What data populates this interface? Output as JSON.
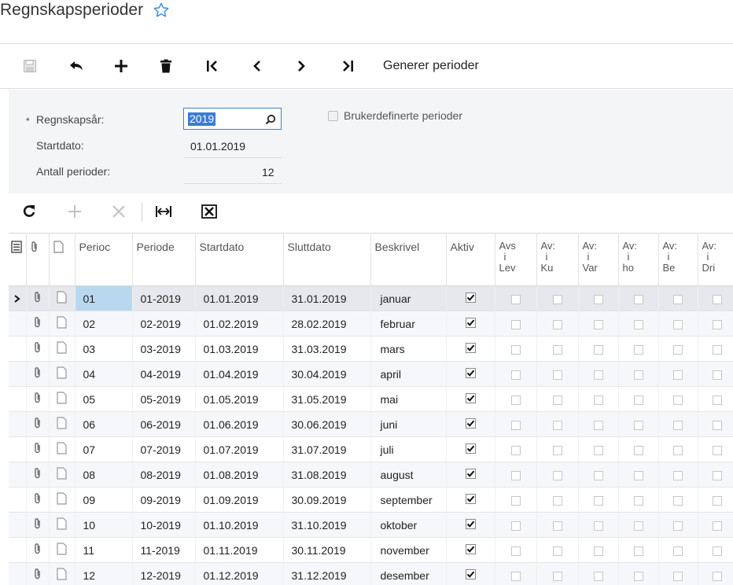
{
  "page": {
    "title": "Regnskapsperioder"
  },
  "toolbar": {
    "generate_label": "Generer perioder"
  },
  "form": {
    "year_label": "Regnskapsår:",
    "required_mark": "*",
    "year_value": "2019",
    "start_label": "Startdato:",
    "start_value": "01.01.2019",
    "count_label": "Antall perioder:",
    "count_value": "12",
    "custom_periods_label": "Brukerdefinerte perioder",
    "custom_periods_checked": false
  },
  "grid": {
    "columns": [
      "Perioc",
      "Periode",
      "Startdato",
      "Sluttdato",
      "Beskrivel",
      "Aktiv",
      "Avs i Lev",
      "Avs i Ku",
      "Avs i Var",
      "Avs i hov",
      "Avs i Be",
      "Avs i Dri"
    ],
    "flag_columns": [
      [
        "Avs",
        "i",
        "Lev"
      ],
      [
        "Av:",
        "i",
        "Ku"
      ],
      [
        "Av:",
        "i",
        "Var"
      ],
      [
        "Av:",
        "i",
        "ho"
      ],
      [
        "Av:",
        "i",
        "Be"
      ],
      [
        "Av:",
        "i",
        "Dri"
      ]
    ],
    "selected_row": 0,
    "rows": [
      {
        "nr": "01",
        "periode": "01-2019",
        "start": "01.01.2019",
        "slutt": "31.01.2019",
        "beskrivelse": "januar",
        "aktiv": true
      },
      {
        "nr": "02",
        "periode": "02-2019",
        "start": "01.02.2019",
        "slutt": "28.02.2019",
        "beskrivelse": "februar",
        "aktiv": true
      },
      {
        "nr": "03",
        "periode": "03-2019",
        "start": "01.03.2019",
        "slutt": "31.03.2019",
        "beskrivelse": "mars",
        "aktiv": true
      },
      {
        "nr": "04",
        "periode": "04-2019",
        "start": "01.04.2019",
        "slutt": "30.04.2019",
        "beskrivelse": "april",
        "aktiv": true
      },
      {
        "nr": "05",
        "periode": "05-2019",
        "start": "01.05.2019",
        "slutt": "31.05.2019",
        "beskrivelse": "mai",
        "aktiv": true
      },
      {
        "nr": "06",
        "periode": "06-2019",
        "start": "01.06.2019",
        "slutt": "30.06.2019",
        "beskrivelse": "juni",
        "aktiv": true
      },
      {
        "nr": "07",
        "periode": "07-2019",
        "start": "01.07.2019",
        "slutt": "31.07.2019",
        "beskrivelse": "juli",
        "aktiv": true
      },
      {
        "nr": "08",
        "periode": "08-2019",
        "start": "01.08.2019",
        "slutt": "31.08.2019",
        "beskrivelse": "august",
        "aktiv": true
      },
      {
        "nr": "09",
        "periode": "09-2019",
        "start": "01.09.2019",
        "slutt": "30.09.2019",
        "beskrivelse": "september",
        "aktiv": true
      },
      {
        "nr": "10",
        "periode": "10-2019",
        "start": "01.10.2019",
        "slutt": "31.10.2019",
        "beskrivelse": "oktober",
        "aktiv": true
      },
      {
        "nr": "11",
        "periode": "11-2019",
        "start": "01.11.2019",
        "slutt": "30.11.2019",
        "beskrivelse": "november",
        "aktiv": true
      },
      {
        "nr": "12",
        "periode": "12-2019",
        "start": "01.12.2019",
        "slutt": "31.12.2019",
        "beskrivelse": "desember",
        "aktiv": true
      }
    ]
  },
  "colors": {
    "accent": "#3a7bd5",
    "star": "#3a8ee6",
    "selected_cell": "#b8d8f0",
    "form_bg": "#f4f5f7"
  }
}
